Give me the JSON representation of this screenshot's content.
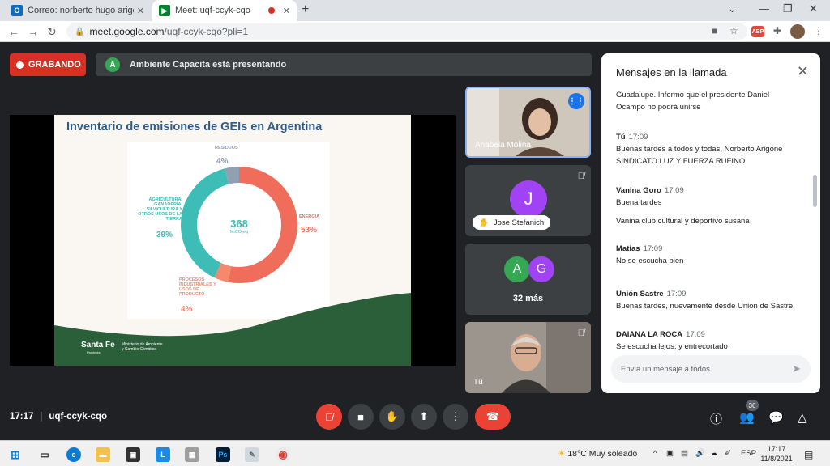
{
  "browser": {
    "tabs": [
      {
        "title": "Correo: norberto hugo arigone -",
        "icon": "outlook-icon"
      },
      {
        "title": "Meet: uqf-ccyk-cqo",
        "icon": "meet-icon"
      }
    ],
    "url_host": "meet.google.com",
    "url_path": "/uqf-ccyk-cqo?pli=1",
    "abp_label": "ABP"
  },
  "meet": {
    "recording_label": "GRABANDO",
    "presenter_initial": "A",
    "presenter_text": "Ambiente Capacita está presentando",
    "meeting_time": "17:17",
    "meeting_code": "uqf-ccyk-cqo",
    "participant_count": "36"
  },
  "slide": {
    "title": "Inventario de emisiones de GEIs en Argentina",
    "center_value": "368",
    "center_unit": "MtCO₂eq",
    "segments": [
      {
        "label": "ENERGÍA",
        "percent": 53,
        "pct_label": "53%",
        "color": "#f06c5b"
      },
      {
        "label": "PROCESOS INDUSTRIALES Y USOS DE PRODUCTO",
        "percent": 4,
        "pct_label": "4%",
        "color": "#f4896c"
      },
      {
        "label": "AGRICULTURA, GANADERÍA, SILVICULTURA Y OTROS USOS DE LA TIERRA",
        "percent": 39,
        "pct_label": "39%",
        "color": "#3dbdb5"
      },
      {
        "label": "RESIDUOS",
        "percent": 4,
        "pct_label": "4%",
        "color": "#8fa0b3"
      }
    ],
    "logo_text": "Santa Fe",
    "logo_sub": "Provincia",
    "ministry_line1": "Ministerio de Ambiente",
    "ministry_line2": "y Cambio Climático"
  },
  "participants": [
    {
      "name": "Anabela Molina",
      "speaking": true
    },
    {
      "name": "Jose Stefanich",
      "initial": "J",
      "color": "#a142f4"
    },
    {
      "label": "32 más",
      "initials": [
        "A",
        "G"
      ],
      "colors": [
        "#34a853",
        "#a142f4"
      ]
    },
    {
      "name": "Tú"
    }
  ],
  "chat": {
    "title": "Mensajes en la llamada",
    "input_placeholder": "Envía un mensaje a todos",
    "messages": [
      {
        "sender": "",
        "time": "",
        "lines": [
          "Guadalupe. Informo que el presidente Daniel",
          "Ocampo no podrá unirse"
        ]
      },
      {
        "sender": "Tú",
        "time": "17:09",
        "lines": [
          "Buenas tardes a todos y todas, Norberto Arigone",
          "SINDICATO LUZ Y FUERZA RUFINO"
        ]
      },
      {
        "sender": "Vanina Goro",
        "time": "17:09",
        "lines": [
          "Buena tardes",
          "",
          "Vanina  club cultural y deportivo susana"
        ]
      },
      {
        "sender": "Matias",
        "time": "17:09",
        "lines": [
          "No se escucha bien"
        ]
      },
      {
        "sender": "Unión Sastre",
        "time": "17:09",
        "lines": [
          "Buenas tardes, nuevamente desde Union de Sastre"
        ]
      },
      {
        "sender": "DAIANA LA ROCA",
        "time": "17:09",
        "lines": [
          "Se escucha lejos, y entrecortado"
        ]
      }
    ]
  },
  "taskbar": {
    "temperature": "18°C",
    "weather": "Muy soleado",
    "language": "ESP",
    "time": "17:17",
    "date": "11/8/2021"
  }
}
